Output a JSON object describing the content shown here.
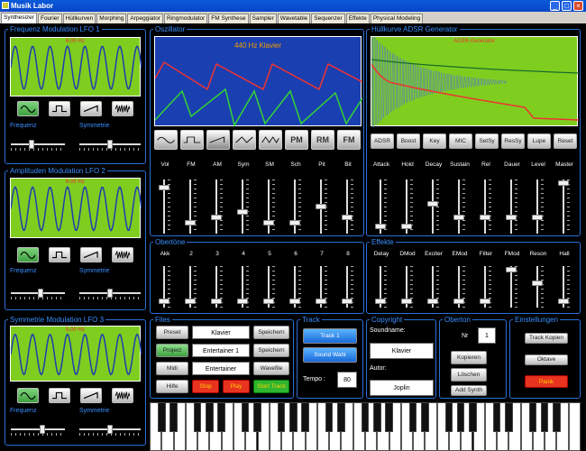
{
  "window": {
    "title": "Musik Labor"
  },
  "tabs": [
    "Synthesizer",
    "Fourier",
    "Hüllkurven",
    "Morphing",
    "Arpeggiator",
    "Ringmodulator",
    "FM Synthese",
    "Sampler",
    "Wavetable",
    "Sequenzer",
    "Effekte",
    "Physical Modeling"
  ],
  "lfo1": {
    "title": "Frequenz Modulation  LFO 1",
    "freq": "6.00 Hz",
    "freq_label": "Frequenz",
    "sym_label": "Symmetrie"
  },
  "lfo2": {
    "title": "Amplituden Modulation  LFO 2",
    "freq": "6.00 Hz",
    "freq_label": "Frequenz",
    "sym_label": "Symmetrie"
  },
  "lfo3": {
    "title": "Symmetrie Modulation  LFO 3",
    "freq": "5.00 Hz",
    "freq_label": "Frequenz",
    "sym_label": "Symmetrie"
  },
  "oscillator": {
    "title": "Oszillator",
    "readout": "440 Hz   Klavier",
    "buttons": [
      "PM",
      "RM",
      "FM"
    ],
    "sliders": [
      {
        "label": "Vol",
        "level": 0.88
      },
      {
        "label": "FM",
        "level": 0.17
      },
      {
        "label": "AM",
        "level": 0.28
      },
      {
        "label": "Sym",
        "level": 0.38
      },
      {
        "label": "SM",
        "level": 0.16
      },
      {
        "label": "Sch",
        "level": 0.16
      },
      {
        "label": "Pit",
        "level": 0.5
      },
      {
        "label": "Bit",
        "level": 0.28
      }
    ]
  },
  "adsr": {
    "title": "Hüllkurve  ADSR Generator",
    "plot_label": "ADSR-Generator",
    "buttons": [
      "ADSR",
      "Boost",
      "Key",
      "MIC",
      "SetSy",
      "ResSy",
      "Lupe",
      "Reset"
    ],
    "sliders": [
      {
        "label": "Attack",
        "level": 0.1
      },
      {
        "label": "Hold",
        "level": 0.1
      },
      {
        "label": "Decay",
        "level": 0.55
      },
      {
        "label": "Sustain",
        "level": 0.28
      },
      {
        "label": "Rel",
        "level": 0.28
      },
      {
        "label": "Dauer",
        "level": 0.28
      },
      {
        "label": "Level",
        "level": 0.28
      },
      {
        "label": "Master",
        "level": 0.98
      }
    ]
  },
  "obertoene": {
    "title": "Obertöne",
    "sliders": [
      {
        "label": "Akk",
        "level": 0.1
      },
      {
        "label": "2",
        "level": 0.1
      },
      {
        "label": "3",
        "level": 0.1
      },
      {
        "label": "4",
        "level": 0.1
      },
      {
        "label": "5",
        "level": 0.1
      },
      {
        "label": "6",
        "level": 0.1
      },
      {
        "label": "7",
        "level": 0.1
      },
      {
        "label": "8",
        "level": 0.1
      }
    ]
  },
  "effekte": {
    "title": "Effekte",
    "sliders": [
      {
        "label": "Delay",
        "level": 0.1
      },
      {
        "label": "DMod",
        "level": 0.1
      },
      {
        "label": "Exciter",
        "level": 0.1
      },
      {
        "label": "EMod",
        "level": 0.1
      },
      {
        "label": "Filter",
        "level": 0.1
      },
      {
        "label": "FMod",
        "level": 0.98
      },
      {
        "label": "Reson",
        "level": 0.6
      },
      {
        "label": "Hall",
        "level": 0.1
      }
    ]
  },
  "files": {
    "title": "Files",
    "preset": "Preset",
    "project": "Project",
    "midi": "Midi",
    "hilfe": "Hilfe",
    "box1": "Klavier",
    "box2": "Entertainer 1",
    "box3": "Entertainer",
    "stop": "Stop",
    "play": "Play",
    "start_track": "Start Track",
    "speichern1": "Speichern",
    "speichern2": "Speichern",
    "wavefile": "Wavefile"
  },
  "track": {
    "title": "Track",
    "track1": "Track 1",
    "sound_wahl": "Sound Wahl",
    "tempo_label": "Tempo :",
    "tempo": "80"
  },
  "copyright": {
    "title": "Copyright",
    "soundname_label": "Soundname:",
    "soundname": "Klavier",
    "autor_label": "Autor:",
    "autor": "Joplin"
  },
  "oberton": {
    "title": "Oberton",
    "nr_label": "Nr",
    "nr": "1",
    "kopieren": "Kopieren",
    "loeschen": "Löschen",
    "add_synth": "Add Synth"
  },
  "einstellungen": {
    "title": "Einstellungen",
    "track_kopien": "Track Kopien",
    "oktave": "Oktave",
    "panik": "Panik"
  }
}
